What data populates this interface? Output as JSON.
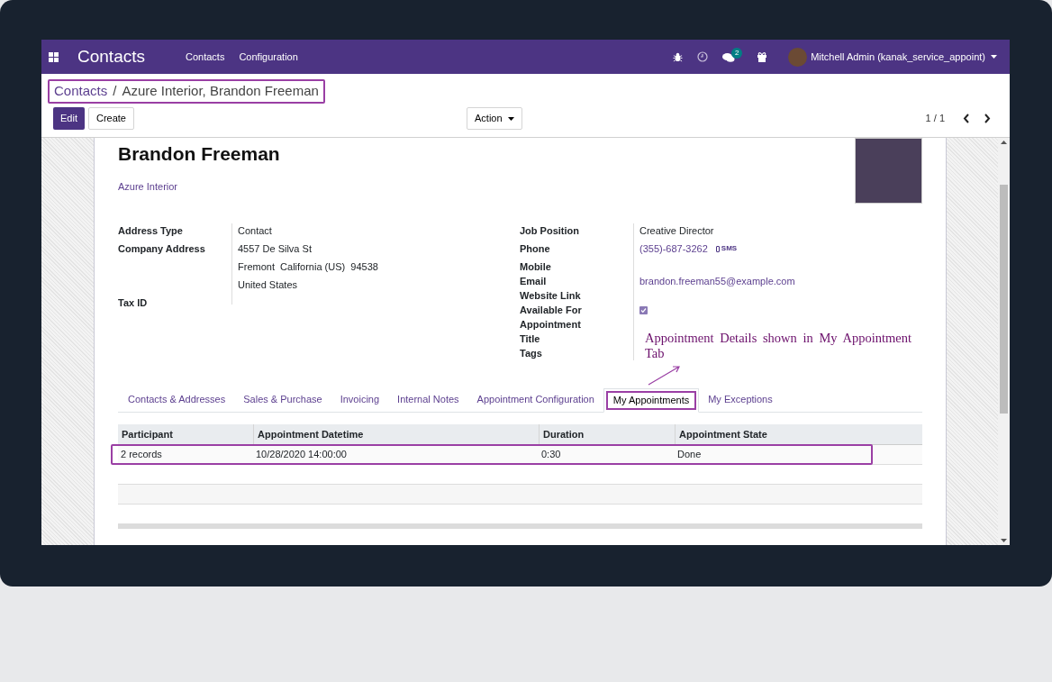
{
  "navbar": {
    "app_title": "Contacts",
    "menu": [
      "Contacts",
      "Configuration"
    ],
    "message_count": "2",
    "user": "Mitchell Admin (kanak_service_appoint)"
  },
  "breadcrumb": {
    "parent": "Contacts",
    "separator": "/",
    "current": "Azure Interior, Brandon Freeman"
  },
  "buttons": {
    "edit": "Edit",
    "create": "Create",
    "action": "Action"
  },
  "pager": "1 / 1",
  "record": {
    "name": "Brandon Freeman",
    "company": "Azure Interior"
  },
  "left_fields": [
    {
      "label": "Address Type",
      "lines": [
        "Contact"
      ]
    },
    {
      "label": "Company Address",
      "lines": [
        "4557 De Silva St",
        "Fremont  California (US)  94538",
        "United States"
      ]
    },
    {
      "label": "Tax ID"
    }
  ],
  "right_fields": [
    {
      "label": "Job Position",
      "kind": "text",
      "value": "Creative Director"
    },
    {
      "label": "Phone",
      "kind": "phone",
      "value": "(355)-687-3262",
      "action": "SMS"
    },
    {
      "label": "Mobile",
      "kind": "empty"
    },
    {
      "label": "Email",
      "kind": "link",
      "value": "brandon.freeman55@example.com"
    },
    {
      "label": "Website Link",
      "kind": "empty"
    },
    {
      "label": "Available For Appointment",
      "kind": "checkbox",
      "checked": true
    },
    {
      "label": "Title",
      "kind": "empty"
    },
    {
      "label": "Tags",
      "kind": "empty"
    }
  ],
  "annotation": "Appointment Details shown in My Appointment Tab",
  "tabs": [
    {
      "label": "Contacts & Addresses",
      "selected": false
    },
    {
      "label": "Sales & Purchase",
      "selected": false
    },
    {
      "label": "Invoicing",
      "selected": false
    },
    {
      "label": "Internal Notes",
      "selected": false
    },
    {
      "label": "Appointment Configuration",
      "selected": false
    },
    {
      "label": "My Appointments",
      "selected": true
    },
    {
      "label": "My Exceptions",
      "selected": false
    }
  ],
  "table": {
    "columns": [
      "Participant",
      "Appointment Datetime",
      "Duration",
      "Appointment State"
    ],
    "rows": [
      [
        "2 records",
        "10/28/2020 14:00:00",
        "0:30",
        "Done"
      ]
    ]
  }
}
